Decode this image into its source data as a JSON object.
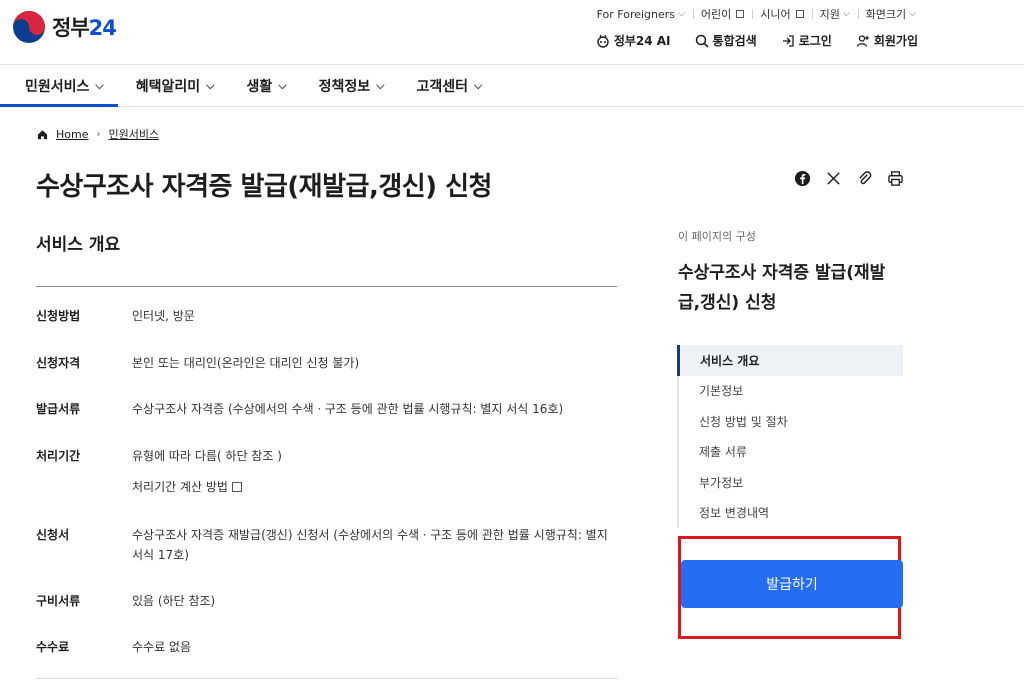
{
  "header": {
    "logo_text": "정부",
    "logo_num": "24",
    "util": [
      {
        "label": "For Foreigners",
        "kind": "dropdown"
      },
      {
        "label": "어린이",
        "kind": "external"
      },
      {
        "label": "시니어",
        "kind": "external"
      },
      {
        "label": "지원",
        "kind": "dropdown"
      },
      {
        "label": "화면크기",
        "kind": "dropdown"
      }
    ],
    "actions": {
      "ai": "정부24 AI",
      "search": "통합검색",
      "login": "로그인",
      "signup": "회원가입"
    }
  },
  "gnb": [
    {
      "label": "민원서비스"
    },
    {
      "label": "혜택알리미"
    },
    {
      "label": "생활"
    },
    {
      "label": "정책정보"
    },
    {
      "label": "고객센터"
    }
  ],
  "breadcrumb": {
    "home": "Home",
    "current": "민원서비스"
  },
  "page": {
    "title": "수상구조사 자격증 발급(재발급,갱신) 신청",
    "section_title": "서비스 개요"
  },
  "overview": [
    {
      "label": "신청방법",
      "value": "인터넷, 방문"
    },
    {
      "label": "신청자격",
      "value": "본인 또는 대리인(온라인은 대리인 신청 불가)"
    },
    {
      "label": "발급서류",
      "value": "수상구조사 자격증 (수상에서의 수색ㆍ구조 등에 관한 법률 시행규칙: 별지 서식 16호)"
    },
    {
      "label": "처리기간",
      "value": "유형에 따라 다름( 하단 참조 )",
      "link": "처리기간 계산 방법"
    },
    {
      "label": "신청서",
      "value": "수상구조사 자격증 재발급(갱신) 신청서 (수상에서의 수색ㆍ구조 등에 관한 법률 시행규칙: 별지 서식 17호)"
    },
    {
      "label": "구비서류",
      "value": "있음 (하단 참조)"
    },
    {
      "label": "수수료",
      "value": "수수료 없음"
    }
  ],
  "sidebar": {
    "caption": "이 페이지의 구성",
    "title": "수상구조사 자격증 발급(재발급,갱신) 신청",
    "toc": [
      {
        "label": "서비스 개요"
      },
      {
        "label": "기본정보"
      },
      {
        "label": "신청 방법 및 절차"
      },
      {
        "label": "제출 서류"
      },
      {
        "label": "부가정보"
      },
      {
        "label": "정보 변경내역"
      }
    ],
    "apply_button": "발급하기"
  },
  "colors": {
    "primary": "#256ef4",
    "nav_active": "#0b50d0",
    "highlight": "#d9191c"
  }
}
